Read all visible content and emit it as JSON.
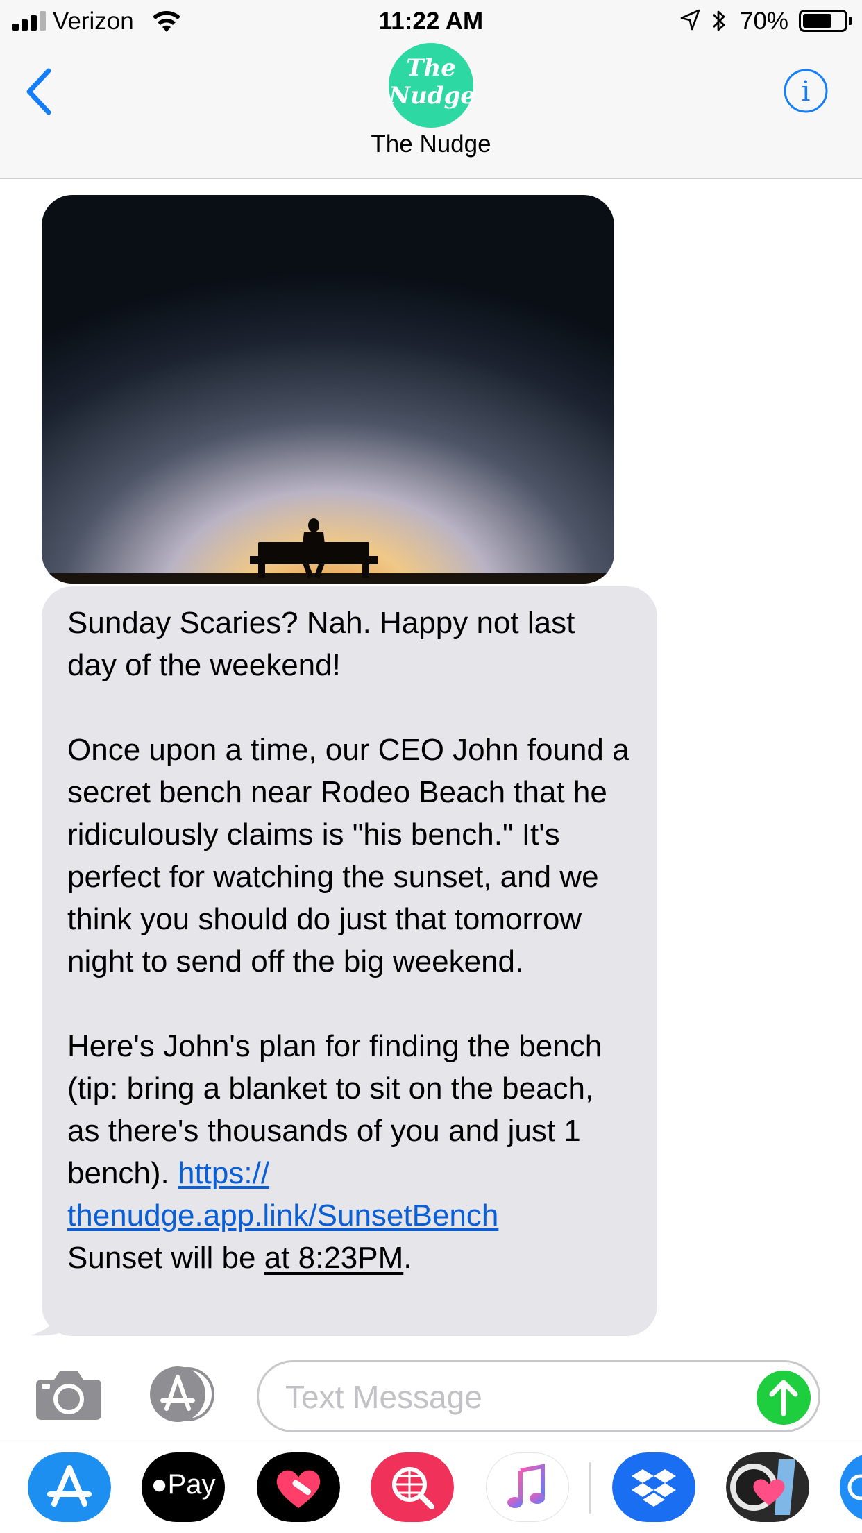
{
  "status_bar": {
    "carrier": "Verizon",
    "time": "11:22 AM",
    "battery_percent": "70%",
    "battery_level": 0.7,
    "signal_bars_filled": 3,
    "signal_bars_total": 4
  },
  "header": {
    "avatar_text_line1": "The",
    "avatar_text_line2": "Nudge",
    "contact_name": "The Nudge",
    "avatar_color": "#2ed8a2"
  },
  "message": {
    "para1": "Sunday Scaries? Nah. Happy not last day of the weekend!",
    "para2": "Once upon a time, our CEO John found a secret bench near Rodeo Beach that he ridiculously claims is \"his bench.\" It's perfect for watching the sunset, and we think you should do just that tomorrow night to send off the big weekend.",
    "para3_text": "Here's John's plan for finding the bench (tip: bring a blanket to sit on the beach, as there's thousands of you and just 1 bench). ",
    "link_line1": "https://",
    "link_line2": "thenudge.app.link/SunsetBench",
    "sunset_prefix": "Sunset will be ",
    "sunset_time": "at 8:23PM",
    "sunset_suffix": "."
  },
  "input": {
    "placeholder": "Text Message"
  },
  "app_drawer": {
    "apple_pay_label": "Pay",
    "icons": [
      "app-store-icon",
      "apple-pay-icon",
      "heart-app-icon",
      "search-globe-icon",
      "music-icon",
      "dropbox-icon",
      "heart-photo-icon",
      "extra-app-icon"
    ]
  },
  "colors": {
    "link": "#0b5fd6",
    "bubble": "#e5e5ea",
    "send": "#1fce3e",
    "ios_blue": "#147efb"
  }
}
